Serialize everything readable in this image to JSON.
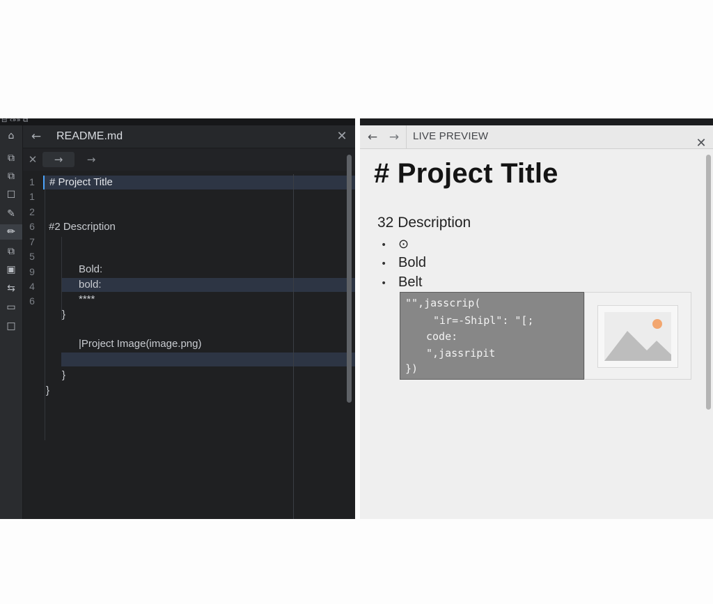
{
  "editor": {
    "strip_text": "⊟ ‹»» ⧉",
    "tab_title": "README.md",
    "back_glyph": "←",
    "close_glyph": "✕",
    "toolbar": {
      "close_glyph": "✕",
      "forward_glyph": "→",
      "forward2_glyph": "→"
    },
    "activity_icons": [
      {
        "name": "home-icon",
        "glyph": "⌂"
      },
      {
        "name": "copy-icon",
        "glyph": "⧉"
      },
      {
        "name": "copy-2-icon",
        "glyph": "⧉"
      },
      {
        "name": "file-icon",
        "glyph": "☐"
      },
      {
        "name": "dropper-icon",
        "glyph": "✎"
      },
      {
        "name": "pencil-icon",
        "glyph": "✏"
      },
      {
        "name": "layers-icon",
        "glyph": "⧉"
      },
      {
        "name": "image-icon",
        "glyph": "▣"
      },
      {
        "name": "transform-icon",
        "glyph": "⇆"
      },
      {
        "name": "folder-icon",
        "glyph": "▭"
      },
      {
        "name": "square-icon",
        "glyph": "□"
      }
    ],
    "gutter": [
      "1",
      "1",
      "2",
      "6",
      "7",
      "5",
      "9",
      "4",
      "6"
    ],
    "lines": [
      "# Project Title",
      "#2 Description",
      "Bold:",
      "bold:",
      "****",
      "}",
      "|Project Image(image.png)",
      "}",
      "}"
    ]
  },
  "preview": {
    "header_title": "LIVE PREVIEW",
    "back_glyph": "←",
    "forward_glyph": "→",
    "close_glyph": "✕",
    "h1": "# Project Title",
    "h2": "32 Description",
    "bullet_glyph": "•",
    "list_items": [
      "⊙",
      "Bold",
      "Belt"
    ],
    "code_lines": [
      "\"\",jasscrip(",
      "\"ir=-Shipl\": \"[;",
      "code:",
      "\",jassripit",
      "})"
    ],
    "image_colors": {
      "mountain": "#bdbdbd",
      "sun": "#f2a66f"
    }
  }
}
